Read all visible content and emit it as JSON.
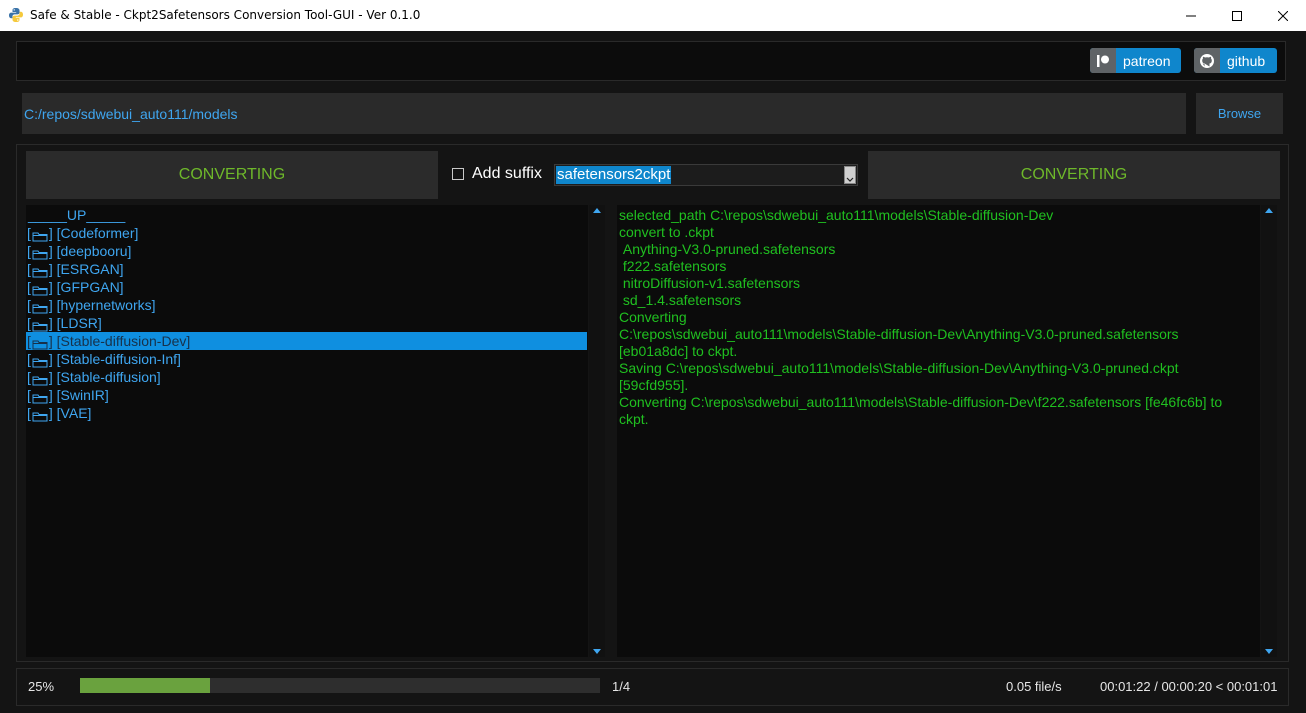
{
  "window": {
    "title": "Safe & Stable - Ckpt2Safetensors Conversion Tool-GUI - Ver 0.1.0"
  },
  "links": {
    "patreon_label": "patreon",
    "github_label": "github"
  },
  "path": {
    "value": "C:/repos/sdwebui_auto111/models",
    "browse_label": "Browse"
  },
  "controls": {
    "convert_left_label": "CONVERTING",
    "convert_right_label": "CONVERTING",
    "add_suffix_label": "Add suffix",
    "add_suffix_checked": false,
    "mode_selected": "safetensors2ckpt"
  },
  "file_list": {
    "up_label": "_____UP_____",
    "items": [
      {
        "label": "[Codeformer]",
        "selected": false
      },
      {
        "label": "[deepbooru]",
        "selected": false
      },
      {
        "label": "[ESRGAN]",
        "selected": false
      },
      {
        "label": "[GFPGAN]",
        "selected": false
      },
      {
        "label": "[hypernetworks]",
        "selected": false
      },
      {
        "label": "[LDSR]",
        "selected": false
      },
      {
        "label": "[Stable-diffusion-Dev]",
        "selected": true
      },
      {
        "label": "[Stable-diffusion-Inf]",
        "selected": false
      },
      {
        "label": "[Stable-diffusion]",
        "selected": false
      },
      {
        "label": "[SwinIR]",
        "selected": false
      },
      {
        "label": "[VAE]",
        "selected": false
      }
    ]
  },
  "log": {
    "lines": [
      "selected_path C:\\repos\\sdwebui_auto111\\models\\Stable-diffusion-Dev",
      "convert to .ckpt",
      " Anything-V3.0-pruned.safetensors",
      " f222.safetensors",
      " nitroDiffusion-v1.safetensors",
      " sd_1.4.safetensors",
      "Converting",
      "C:\\repos\\sdwebui_auto111\\models\\Stable-diffusion-Dev\\Anything-V3.0-pruned.safetensors",
      "[eb01a8dc] to ckpt.",
      "Saving C:\\repos\\sdwebui_auto111\\models\\Stable-diffusion-Dev\\Anything-V3.0-pruned.ckpt",
      "[59cfd955].",
      "Converting C:\\repos\\sdwebui_auto111\\models\\Stable-diffusion-Dev\\f222.safetensors [fe46fc6b] to",
      "ckpt."
    ]
  },
  "status": {
    "percent_label": "25%",
    "progress_fraction": 0.25,
    "count_label": "1/4",
    "rate_label": "0.05 file/s",
    "time_label": "00:01:22 / 00:00:20 < 00:01:01"
  },
  "colors": {
    "accent_blue": "#0f86cc",
    "list_text": "#3fa6f0",
    "log_text": "#20c020",
    "convert_text": "#6eb82a",
    "progress_fill": "#6aa23e"
  }
}
